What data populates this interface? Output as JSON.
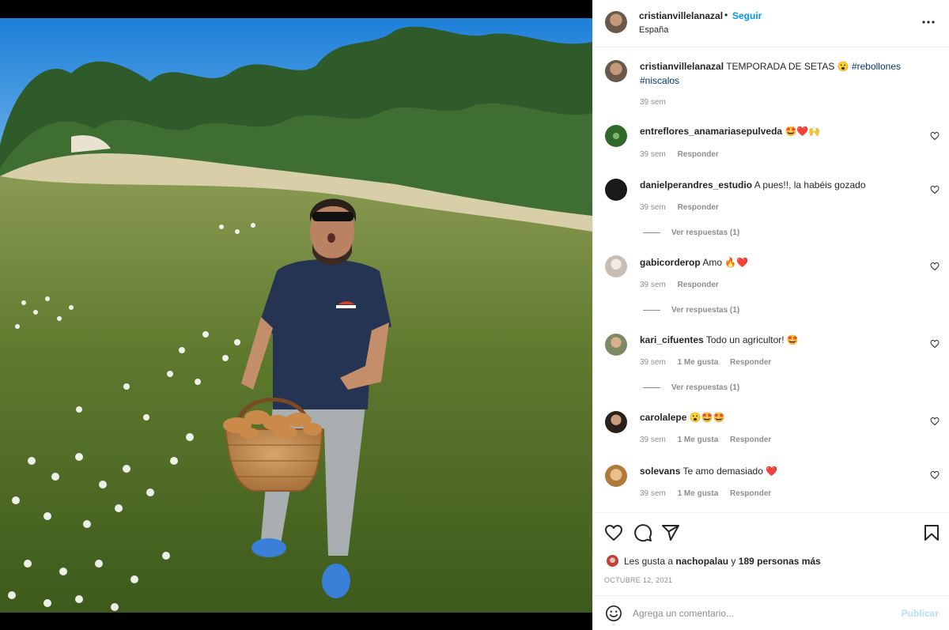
{
  "post": {
    "username": "cristianvillelanazal",
    "follow_label": "Seguir",
    "separator": "•",
    "location": "España",
    "caption": "TEMPORADA DE SETAS 😮",
    "hashtags": [
      "#rebollones",
      "#niscalos"
    ],
    "caption_time": "39 sem"
  },
  "comments": [
    {
      "user": "entreflores_anamariasepulveda",
      "text": "🤩❤️🙌",
      "time": "39 sem",
      "likes": "",
      "reply": "Responder",
      "replies": ""
    },
    {
      "user": "danielperandres_estudio",
      "text": "A pues!!, la habéis gozado",
      "time": "39 sem",
      "likes": "",
      "reply": "Responder",
      "replies": "Ver respuestas (1)"
    },
    {
      "user": "gabicorderop",
      "text": "Amo 🔥❤️",
      "time": "39 sem",
      "likes": "",
      "reply": "Responder",
      "replies": "Ver respuestas (1)"
    },
    {
      "user": "kari_cifuentes",
      "text": "Todo un agricultor! 🤩",
      "time": "39 sem",
      "likes": "1 Me gusta",
      "reply": "Responder",
      "replies": "Ver respuestas (1)"
    },
    {
      "user": "carolalepe",
      "text": "😮🤩🤩",
      "time": "39 sem",
      "likes": "1 Me gusta",
      "reply": "Responder",
      "replies": ""
    },
    {
      "user": "solevans",
      "text": "Te amo demasiado ❤️",
      "time": "39 sem",
      "likes": "1 Me gusta",
      "reply": "Responder",
      "replies": ""
    }
  ],
  "likes_line": {
    "prefix": "Les gusta a",
    "liker": "nachopalau",
    "connector": "y",
    "others": "189 personas más"
  },
  "date": "OCTUBRE 12, 2021",
  "add_comment": {
    "placeholder": "Agrega un comentario...",
    "publish_label": "Publicar"
  },
  "colors": {
    "link": "#0095f6",
    "hashtag": "#00376b",
    "muted": "#8e8e8e",
    "publish_disabled": "#b2dffc"
  },
  "icons": [
    "more-options-icon",
    "heart-icon",
    "comment-icon",
    "share-icon",
    "bookmark-icon",
    "emoji-icon"
  ]
}
